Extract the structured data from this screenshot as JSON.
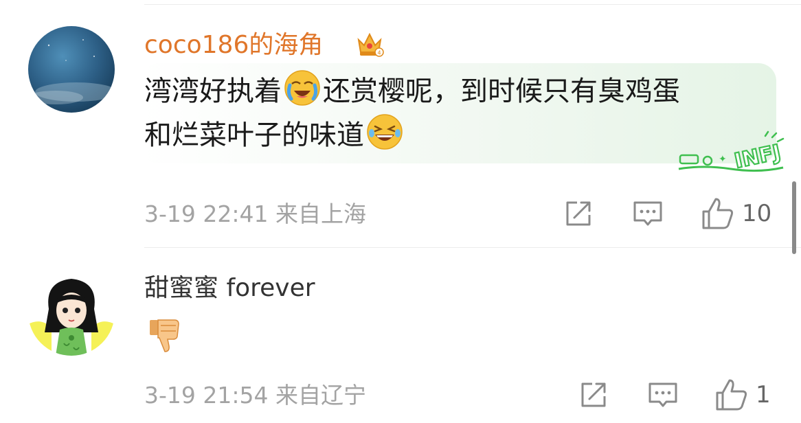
{
  "comments": [
    {
      "username": "coco186的海角",
      "text_part1": "湾湾好执着",
      "text_part2": "还赏樱呢，到时候只有臭鸡蛋",
      "text_part3": "和烂菜叶子的味道",
      "meta": "3-19 22:41 来自上海",
      "like_count": "10",
      "badge_text": "INFJ"
    },
    {
      "username": "甜蜜蜜 forever",
      "meta": "3-19 21:54 来自辽宁",
      "like_count": "1"
    }
  ],
  "colors": {
    "username_vip": "#e0762a",
    "username_normal": "#333333",
    "meta_gray": "#a3a3a3",
    "icon_gray": "#8a8a8a",
    "badge_green": "#3fbf4f"
  },
  "icons": {
    "share": "share-icon",
    "comment": "comment-icon",
    "like": "like-icon",
    "crown": "crown-icon",
    "emoji_cry_laugh": "crying-face-emoji",
    "emoji_laugh": "laughing-emoji",
    "thumbs_down": "thumbs-down-emoji"
  }
}
